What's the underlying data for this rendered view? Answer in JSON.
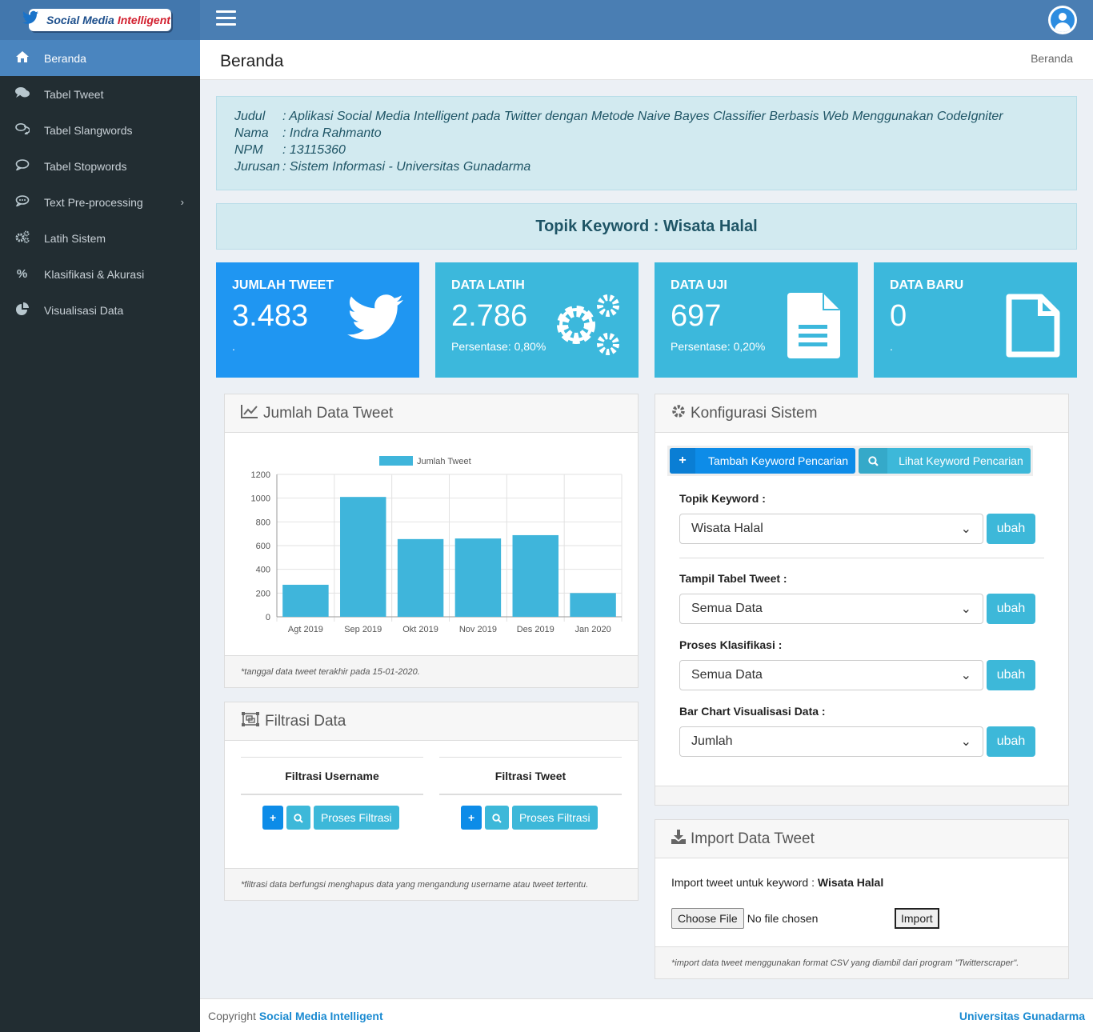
{
  "header": {
    "logo_text_a": "Social Media",
    "logo_text_b": "Intelligent"
  },
  "sidebar": {
    "items": [
      {
        "label": "Beranda",
        "icon": "home-icon"
      },
      {
        "label": "Tabel Tweet",
        "icon": "comments-icon"
      },
      {
        "label": "Tabel Slangwords",
        "icon": "comments-outline-icon"
      },
      {
        "label": "Tabel Stopwords",
        "icon": "comment-icon"
      },
      {
        "label": "Text Pre-processing",
        "icon": "commenting-icon"
      },
      {
        "label": "Latih Sistem",
        "icon": "cogs-icon"
      },
      {
        "label": "Klasifikasi & Akurasi",
        "icon": "percent-icon"
      },
      {
        "label": "Visualisasi Data",
        "icon": "pie-chart-icon"
      }
    ]
  },
  "page": {
    "title": "Beranda",
    "breadcrumb": "Beranda"
  },
  "info": {
    "judul_label": "Judul",
    "judul_value": ": Aplikasi Social Media Intelligent pada Twitter dengan Metode Naive Bayes Classifier Berbasis Web Menggunakan CodeIgniter",
    "nama_label": "Nama",
    "nama_value": ": Indra Rahmanto",
    "npm_label": "NPM",
    "npm_value": ": 13115360",
    "jurusan_label": "Jurusan",
    "jurusan_value": ": Sistem Informasi - Universitas Gunadarma"
  },
  "topic": "Topik Keyword : Wisata Halal",
  "stats": [
    {
      "title": "JUMLAH TWEET",
      "value": "3.483",
      "sub": ".",
      "color": "#1f96f2",
      "icon": "twitter-icon"
    },
    {
      "title": "DATA LATIH",
      "value": "2.786",
      "sub": "Persentase: 0,80%",
      "color": "#3cb8dc",
      "icon": "cogs-icon"
    },
    {
      "title": "DATA UJI",
      "value": "697",
      "sub": "Persentase: 0,20%",
      "color": "#3cb8dc",
      "icon": "file-text-icon"
    },
    {
      "title": "DATA BARU",
      "value": "0",
      "sub": ".",
      "color": "#3cb8dc",
      "icon": "file-outline-icon"
    }
  ],
  "chart_panel": {
    "title": "Jumlah Data Tweet",
    "footer": "*tanggal data tweet terakhir pada 15-01-2020."
  },
  "chart_data": {
    "type": "bar",
    "categories": [
      "Agt 2019",
      "Sep 2019",
      "Okt 2019",
      "Nov 2019",
      "Des 2019",
      "Jan 2020"
    ],
    "series": [
      {
        "name": "Jumlah Tweet",
        "values": [
          270,
          1010,
          655,
          660,
          688,
          200
        ],
        "color": "#3fb5db"
      }
    ],
    "yticks": [
      "0",
      "200",
      "400",
      "600",
      "800",
      "1000",
      "1200"
    ],
    "ylim": [
      0,
      1200
    ],
    "grid": true,
    "legend": "top"
  },
  "filter_panel": {
    "title": "Filtrasi Data",
    "col1_title": "Filtrasi Username",
    "col2_title": "Filtrasi Tweet",
    "process_label": "Proses Filtrasi",
    "footer": "*filtrasi data berfungsi menghapus data yang mengandung username atau tweet tertentu."
  },
  "config_panel": {
    "title": "Konfigurasi Sistem",
    "add_keyword": "Tambah Keyword Pencarian",
    "view_keyword": "Lihat Keyword Pencarian",
    "fields": [
      {
        "label": "Topik Keyword :",
        "value": "Wisata Halal",
        "button": "ubah"
      },
      {
        "label": "Tampil Tabel Tweet :",
        "value": "Semua Data",
        "button": "ubah"
      },
      {
        "label": "Proses Klasifikasi :",
        "value": "Semua Data",
        "button": "ubah"
      },
      {
        "label": "Bar Chart Visualisasi Data :",
        "value": "Jumlah",
        "button": "ubah"
      }
    ]
  },
  "import_panel": {
    "title": "Import Data Tweet",
    "text": "Import tweet untuk keyword :",
    "keyword": "Wisata Halal",
    "choose_file": "Choose File",
    "no_file": "No file chosen",
    "import_btn": "Import",
    "footer": "*import data tweet menggunakan format CSV yang diambil dari program \"Twitterscraper\"."
  },
  "footer": {
    "copyright": "Copyright",
    "app_name": "Social Media Intelligent",
    "university": "Universitas Gunadarma"
  }
}
